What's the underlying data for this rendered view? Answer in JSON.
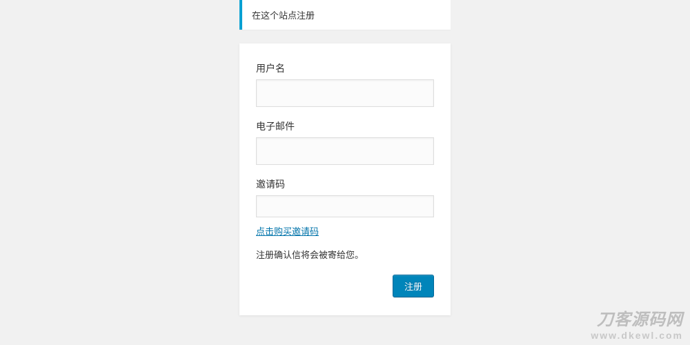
{
  "notice": {
    "text": "在这个站点注册"
  },
  "form": {
    "username": {
      "label": "用户名",
      "value": ""
    },
    "email": {
      "label": "电子邮件",
      "value": ""
    },
    "invite": {
      "label": "邀请码",
      "value": "",
      "buy_link": "点击购买邀请码"
    },
    "confirm_note": "注册确认信将会被寄给您。",
    "submit_label": "注册"
  },
  "watermark": {
    "line1": "刀客源码网",
    "line2": "www.dkewl.com"
  }
}
